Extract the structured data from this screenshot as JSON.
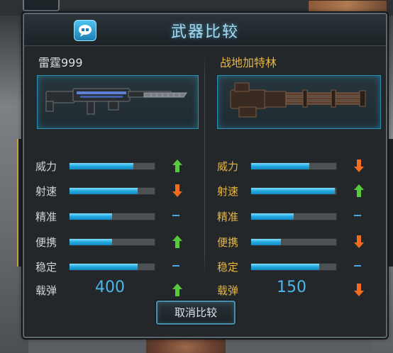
{
  "dialog": {
    "title": "武器比较",
    "cancel_label": "取消比较"
  },
  "left_weapon": {
    "name": "雷霆999",
    "stats": [
      {
        "label": "威力",
        "level": 0.75,
        "change": "up"
      },
      {
        "label": "射速",
        "level": 0.8,
        "change": "down"
      },
      {
        "label": "精准",
        "level": 0.5,
        "change": "same"
      },
      {
        "label": "便携",
        "level": 0.5,
        "change": "up"
      },
      {
        "label": "稳定",
        "level": 0.8,
        "change": "same"
      }
    ],
    "ammo_label": "载弹",
    "ammo_value": "400",
    "ammo_change": "up"
  },
  "right_weapon": {
    "name": "战地加特林",
    "stats": [
      {
        "label": "威力",
        "level": 0.68,
        "change": "down"
      },
      {
        "label": "射速",
        "level": 0.98,
        "change": "up"
      },
      {
        "label": "精准",
        "level": 0.5,
        "change": "same"
      },
      {
        "label": "便携",
        "level": 0.35,
        "change": "down"
      },
      {
        "label": "稳定",
        "level": 0.8,
        "change": "same"
      }
    ],
    "ammo_label": "载弹",
    "ammo_value": "150",
    "ammo_change": "down"
  },
  "colors": {
    "up": "#57c93b",
    "down": "#f36b21",
    "same": "#4aa7e0",
    "accent": "#2b8fb3"
  }
}
